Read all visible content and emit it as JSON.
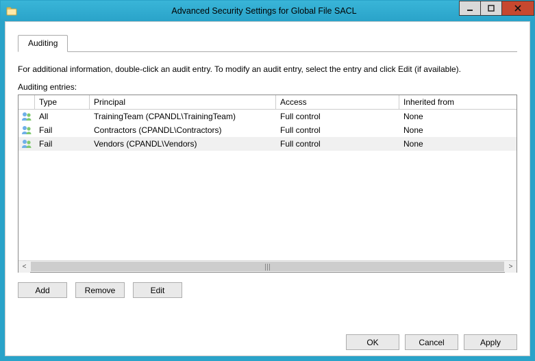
{
  "window": {
    "title": "Advanced Security Settings for Global File SACL"
  },
  "tab": {
    "auditing": "Auditing"
  },
  "info": "For additional information, double-click an audit entry. To modify an audit entry, select the entry and click Edit (if available).",
  "list_label": "Auditing entries:",
  "columns": {
    "type": "Type",
    "principal": "Principal",
    "access": "Access",
    "inherited": "Inherited from"
  },
  "rows": [
    {
      "type": "All",
      "principal": "TrainingTeam (CPANDL\\TrainingTeam)",
      "access": "Full control",
      "inherited": "None"
    },
    {
      "type": "Fail",
      "principal": "Contractors (CPANDL\\Contractors)",
      "access": "Full control",
      "inherited": "None"
    },
    {
      "type": "Fail",
      "principal": "Vendors (CPANDL\\Vendors)",
      "access": "Full control",
      "inherited": "None"
    }
  ],
  "buttons": {
    "add": "Add",
    "remove": "Remove",
    "edit": "Edit",
    "ok": "OK",
    "cancel": "Cancel",
    "apply": "Apply"
  }
}
